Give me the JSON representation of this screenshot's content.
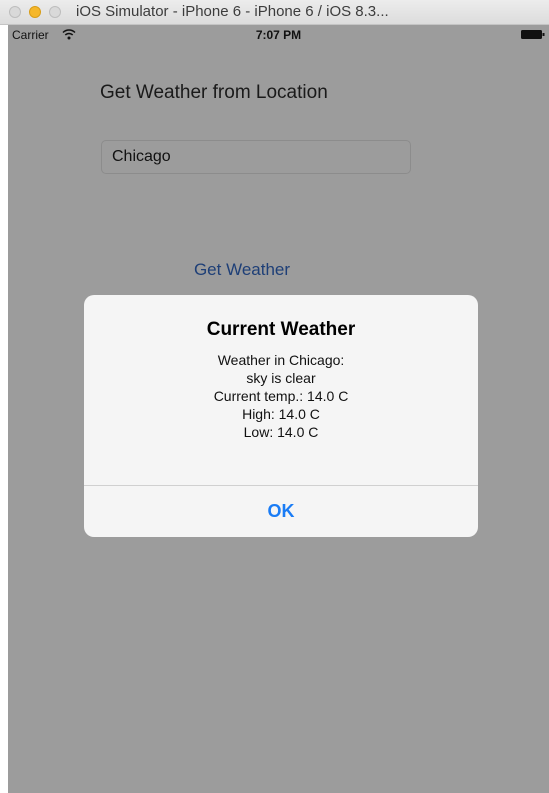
{
  "window": {
    "title": "iOS Simulator - iPhone 6 - iPhone 6 / iOS 8.3..."
  },
  "status_bar": {
    "carrier": "Carrier",
    "time": "7:07 PM",
    "icons": [
      "wifi-icon",
      "battery-icon"
    ]
  },
  "app": {
    "heading": "Get Weather from Location",
    "city_input_value": "Chicago",
    "get_weather_label": "Get Weather"
  },
  "alert": {
    "title": "Current Weather",
    "message_lines": [
      "Weather in Chicago:",
      "sky is clear",
      "Current temp.: 14.0 C",
      "High: 14.0 C",
      "Low: 14.0 C"
    ],
    "ok_label": "OK"
  },
  "colors": {
    "dimmed_background": "#9c9c9c",
    "tint_blue": "#1a7cf5",
    "dimmed_tint_blue": "#1e3f77",
    "minimize_yellow": "#f5b72a"
  }
}
